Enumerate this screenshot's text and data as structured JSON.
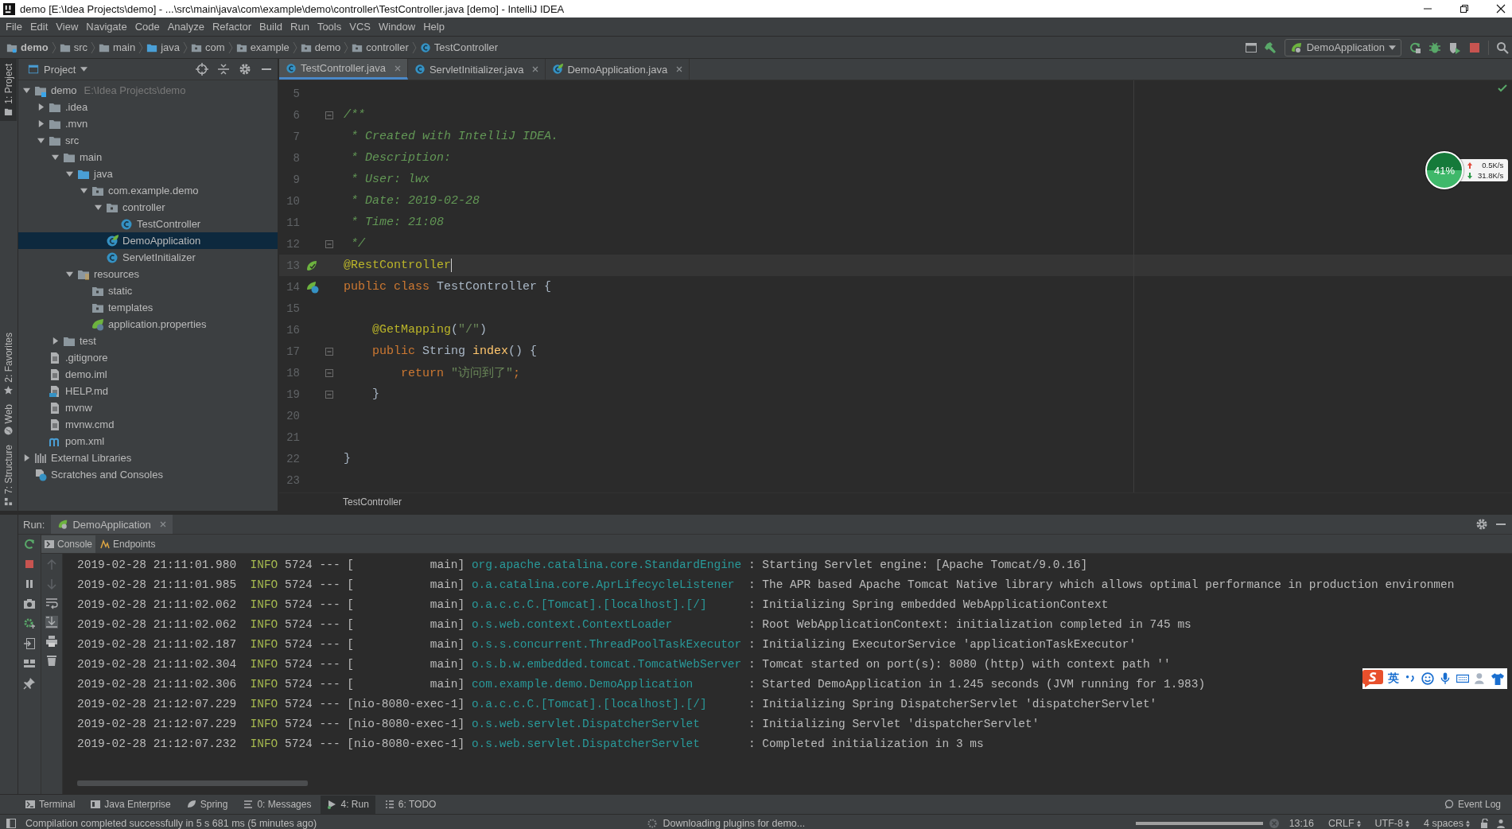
{
  "window": {
    "title": "demo [E:\\Idea Projects\\demo] - ...\\src\\main\\java\\com\\example\\demo\\controller\\TestController.java [demo] - IntelliJ IDEA"
  },
  "menu": [
    "File",
    "Edit",
    "View",
    "Navigate",
    "Code",
    "Analyze",
    "Refactor",
    "Build",
    "Run",
    "Tools",
    "VCS",
    "Window",
    "Help"
  ],
  "breadcrumbs": [
    {
      "label": "demo",
      "kind": "module"
    },
    {
      "label": "src",
      "kind": "folder"
    },
    {
      "label": "main",
      "kind": "folder"
    },
    {
      "label": "java",
      "kind": "source"
    },
    {
      "label": "com",
      "kind": "package"
    },
    {
      "label": "example",
      "kind": "package"
    },
    {
      "label": "demo",
      "kind": "package"
    },
    {
      "label": "controller",
      "kind": "package"
    },
    {
      "label": "TestController",
      "kind": "class"
    }
  ],
  "run_config": {
    "label": "DemoApplication"
  },
  "left_stripe": {
    "top": [
      {
        "label": "1: Project",
        "selected": true
      }
    ],
    "bottom": [
      {
        "label": "2: Favorites",
        "kind": "star",
        "selected": false
      },
      {
        "label": "Web",
        "kind": "globe",
        "selected": false
      },
      {
        "label": "7: Structure",
        "kind": "structure",
        "selected": false
      }
    ]
  },
  "project": {
    "title": "Project",
    "tree": [
      {
        "label": "demo",
        "hint": "E:\\Idea Projects\\demo",
        "kind": "module",
        "expanded": true,
        "selected": false,
        "children": [
          {
            "label": ".idea",
            "kind": "folder",
            "expanded": false,
            "selected": false
          },
          {
            "label": ".mvn",
            "kind": "folder",
            "expanded": false,
            "selected": false
          },
          {
            "label": "src",
            "kind": "folder",
            "expanded": true,
            "selected": false,
            "children": [
              {
                "label": "main",
                "kind": "folder",
                "expanded": true,
                "selected": false,
                "children": [
                  {
                    "label": "java",
                    "kind": "source",
                    "expanded": true,
                    "selected": false,
                    "children": [
                      {
                        "label": "com.example.demo",
                        "kind": "package",
                        "expanded": true,
                        "selected": false,
                        "children": [
                          {
                            "label": "controller",
                            "kind": "package",
                            "expanded": true,
                            "selected": false,
                            "children": [
                              {
                                "label": "TestController",
                                "kind": "class",
                                "selected": false
                              }
                            ]
                          },
                          {
                            "label": "DemoApplication",
                            "kind": "spring-class",
                            "selected": true
                          },
                          {
                            "label": "ServletInitializer",
                            "kind": "class",
                            "selected": false
                          }
                        ]
                      }
                    ]
                  },
                  {
                    "label": "resources",
                    "kind": "resources",
                    "expanded": true,
                    "selected": false,
                    "children": [
                      {
                        "label": "static",
                        "kind": "package",
                        "selected": false
                      },
                      {
                        "label": "templates",
                        "kind": "package",
                        "selected": false
                      },
                      {
                        "label": "application.properties",
                        "kind": "spring-props",
                        "selected": false
                      }
                    ]
                  }
                ]
              },
              {
                "label": "test",
                "kind": "folder",
                "expanded": false,
                "selected": false
              }
            ]
          },
          {
            "label": ".gitignore",
            "kind": "file",
            "selected": false
          },
          {
            "label": "demo.iml",
            "kind": "file",
            "selected": false
          },
          {
            "label": "HELP.md",
            "kind": "md",
            "selected": false
          },
          {
            "label": "mvnw",
            "kind": "file",
            "selected": false
          },
          {
            "label": "mvnw.cmd",
            "kind": "file",
            "selected": false
          },
          {
            "label": "pom.xml",
            "kind": "maven",
            "selected": false
          }
        ]
      },
      {
        "label": "External Libraries",
        "kind": "libs",
        "expanded": false,
        "selected": false
      },
      {
        "label": "Scratches and Consoles",
        "kind": "scratches",
        "selected": false
      }
    ]
  },
  "editor": {
    "tabs": [
      {
        "label": "TestController.java",
        "kind": "class",
        "selected": true
      },
      {
        "label": "ServletInitializer.java",
        "kind": "class",
        "selected": false
      },
      {
        "label": "DemoApplication.java",
        "kind": "spring-class",
        "selected": false
      }
    ],
    "lines": [
      {
        "number": "5",
        "current": false,
        "fold": false
      },
      {
        "number": "6",
        "current": false,
        "fold": true,
        "tokens": [
          {
            "kind": "comment",
            "text": "/**"
          }
        ]
      },
      {
        "number": "7",
        "current": false,
        "fold": false,
        "tokens": [
          {
            "kind": "comment",
            "text": " * Created with IntelliJ IDEA."
          }
        ]
      },
      {
        "number": "8",
        "current": false,
        "fold": false,
        "tokens": [
          {
            "kind": "comment",
            "text": " * Description:"
          }
        ]
      },
      {
        "number": "9",
        "current": false,
        "fold": false,
        "tokens": [
          {
            "kind": "comment",
            "text": " * User: lwx"
          }
        ]
      },
      {
        "number": "10",
        "current": false,
        "fold": false,
        "tokens": [
          {
            "kind": "comment",
            "text": " * Date: 2019-02-28"
          }
        ]
      },
      {
        "number": "11",
        "current": false,
        "fold": false,
        "tokens": [
          {
            "kind": "comment",
            "text": " * Time: 21:08"
          }
        ]
      },
      {
        "number": "12",
        "current": false,
        "fold": true,
        "tokens": [
          {
            "kind": "comment",
            "text": " */"
          }
        ]
      },
      {
        "number": "13",
        "current": true,
        "fold": false,
        "kind": "bean",
        "tokens": [
          {
            "kind": "annotation",
            "text": "@RestController"
          }
        ]
      },
      {
        "number": "14",
        "current": false,
        "fold": false,
        "kind": "spring-class",
        "tokens": [
          {
            "kind": "keyword",
            "text": "public class "
          },
          {
            "kind": "plain",
            "text": "TestController {"
          }
        ]
      },
      {
        "number": "15",
        "current": false,
        "fold": false
      },
      {
        "number": "16",
        "current": false,
        "fold": false,
        "tokens": [
          {
            "kind": "annotation",
            "text": "    @GetMapping"
          },
          {
            "kind": "plain",
            "text": "("
          },
          {
            "kind": "string",
            "text": "\"/\""
          },
          {
            "kind": "plain",
            "text": ")"
          }
        ]
      },
      {
        "number": "17",
        "current": false,
        "fold": true,
        "tokens": [
          {
            "kind": "keyword",
            "text": "    public "
          },
          {
            "kind": "plain",
            "text": "String "
          },
          {
            "kind": "method",
            "text": "index"
          },
          {
            "kind": "plain",
            "text": "() {"
          }
        ]
      },
      {
        "number": "18",
        "current": false,
        "fold": true,
        "tokens": [
          {
            "kind": "keyword",
            "text": "        return "
          },
          {
            "kind": "string",
            "text": "\"访问到了\""
          },
          {
            "kind": "keyword",
            "text": ";"
          }
        ]
      },
      {
        "number": "19",
        "current": false,
        "fold": true,
        "tokens": [
          {
            "kind": "plain",
            "text": "    }"
          }
        ]
      },
      {
        "number": "20",
        "current": false,
        "fold": false
      },
      {
        "number": "21",
        "current": false,
        "fold": false
      },
      {
        "number": "22",
        "current": false,
        "fold": false,
        "tokens": [
          {
            "kind": "plain",
            "text": "}"
          }
        ]
      },
      {
        "number": "23",
        "current": false,
        "fold": false
      }
    ],
    "breadcrumb": "TestController"
  },
  "net_monitor": {
    "percent": "41%",
    "upload": "0.5K/s",
    "download": "31.8K/s"
  },
  "ime_bar": {
    "mode": "英"
  },
  "run": {
    "label": "Run:",
    "tabs": [
      {
        "label": "DemoApplication",
        "selected": true
      }
    ],
    "subtabs": [
      {
        "label": "Console",
        "kind": "console",
        "selected": true
      },
      {
        "label": "Endpoints",
        "kind": "endpoints",
        "selected": false
      }
    ],
    "log": [
      {
        "time": "2019-02-28 21:11:01.980",
        "severity": "INFO",
        "pid": "5724",
        "sep": "---",
        "thread": "[           main]",
        "logger": "org.apache.catalina.core.StandardEngine",
        "message": ": Starting Servlet engine: [Apache Tomcat/9.0.16]"
      },
      {
        "time": "2019-02-28 21:11:01.985",
        "severity": "INFO",
        "pid": "5724",
        "sep": "---",
        "thread": "[           main]",
        "logger": "o.a.catalina.core.AprLifecycleListener",
        "message": ": The APR based Apache Tomcat Native library which allows optimal performance in production environmen"
      },
      {
        "time": "2019-02-28 21:11:02.062",
        "severity": "INFO",
        "pid": "5724",
        "sep": "---",
        "thread": "[           main]",
        "logger": "o.a.c.c.C.[Tomcat].[localhost].[/]",
        "message": ": Initializing Spring embedded WebApplicationContext"
      },
      {
        "time": "2019-02-28 21:11:02.062",
        "severity": "INFO",
        "pid": "5724",
        "sep": "---",
        "thread": "[           main]",
        "logger": "o.s.web.context.ContextLoader",
        "message": ": Root WebApplicationContext: initialization completed in 745 ms"
      },
      {
        "time": "2019-02-28 21:11:02.187",
        "severity": "INFO",
        "pid": "5724",
        "sep": "---",
        "thread": "[           main]",
        "logger": "o.s.s.concurrent.ThreadPoolTaskExecutor",
        "message": ": Initializing ExecutorService 'applicationTaskExecutor'"
      },
      {
        "time": "2019-02-28 21:11:02.304",
        "severity": "INFO",
        "pid": "5724",
        "sep": "---",
        "thread": "[           main]",
        "logger": "o.s.b.w.embedded.tomcat.TomcatWebServer",
        "message": ": Tomcat started on port(s): 8080 (http) with context path ''"
      },
      {
        "time": "2019-02-28 21:11:02.306",
        "severity": "INFO",
        "pid": "5724",
        "sep": "---",
        "thread": "[           main]",
        "logger": "com.example.demo.DemoApplication",
        "message": ": Started DemoApplication in 1.245 seconds (JVM running for 1.983)"
      },
      {
        "time": "2019-02-28 21:12:07.229",
        "severity": "INFO",
        "pid": "5724",
        "sep": "---",
        "thread": "[nio-8080-exec-1]",
        "logger": "o.a.c.c.C.[Tomcat].[localhost].[/]",
        "message": ": Initializing Spring DispatcherServlet 'dispatcherServlet'"
      },
      {
        "time": "2019-02-28 21:12:07.229",
        "severity": "INFO",
        "pid": "5724",
        "sep": "---",
        "thread": "[nio-8080-exec-1]",
        "logger": "o.s.web.servlet.DispatcherServlet",
        "message": ": Initializing Servlet 'dispatcherServlet'"
      },
      {
        "time": "2019-02-28 21:12:07.232",
        "severity": "INFO",
        "pid": "5724",
        "sep": "---",
        "thread": "[nio-8080-exec-1]",
        "logger": "o.s.web.servlet.DispatcherServlet",
        "message": ": Completed initialization in 3 ms"
      }
    ]
  },
  "tool_buttons": [
    {
      "label": "Terminal",
      "kind": "terminal",
      "selected": false
    },
    {
      "label": "Java Enterprise",
      "kind": "enterprise",
      "selected": false
    },
    {
      "label": "Spring",
      "kind": "spring",
      "selected": false
    },
    {
      "label": "0: Messages",
      "kind": "messages",
      "selected": false
    },
    {
      "label": "4: Run",
      "kind": "run",
      "selected": true
    },
    {
      "label": "6: TODO",
      "kind": "todo",
      "selected": false
    }
  ],
  "event_log": "Event Log",
  "status": {
    "message": "Compilation completed successfully in 5 s 681 ms (5 minutes ago)",
    "task": "Downloading plugins for demo...",
    "level": 1,
    "position": "13:16",
    "items": [
      "CRLF",
      "UTF-8",
      "4 spaces"
    ]
  }
}
